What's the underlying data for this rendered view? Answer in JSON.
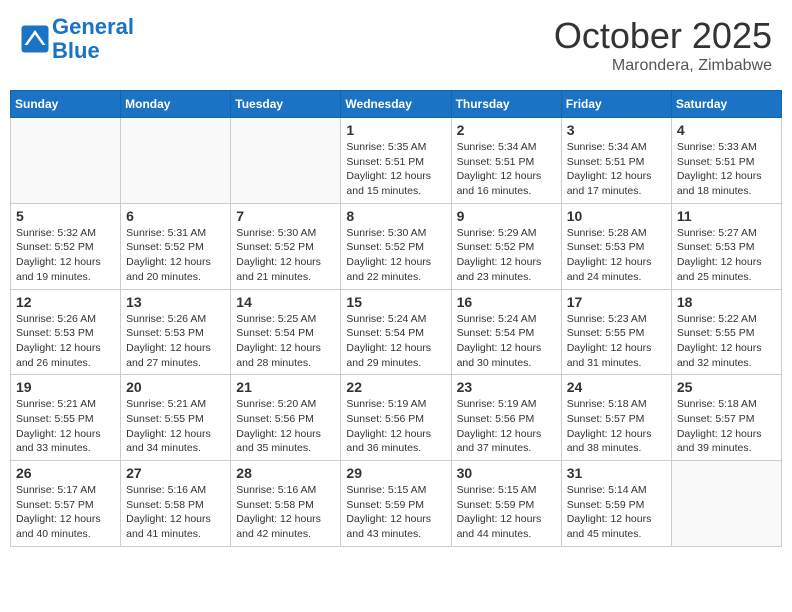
{
  "header": {
    "logo_line1": "General",
    "logo_line2": "Blue",
    "month": "October 2025",
    "location": "Marondera, Zimbabwe"
  },
  "weekdays": [
    "Sunday",
    "Monday",
    "Tuesday",
    "Wednesday",
    "Thursday",
    "Friday",
    "Saturday"
  ],
  "weeks": [
    [
      {
        "day": "",
        "info": ""
      },
      {
        "day": "",
        "info": ""
      },
      {
        "day": "",
        "info": ""
      },
      {
        "day": "1",
        "info": "Sunrise: 5:35 AM\nSunset: 5:51 PM\nDaylight: 12 hours\nand 15 minutes."
      },
      {
        "day": "2",
        "info": "Sunrise: 5:34 AM\nSunset: 5:51 PM\nDaylight: 12 hours\nand 16 minutes."
      },
      {
        "day": "3",
        "info": "Sunrise: 5:34 AM\nSunset: 5:51 PM\nDaylight: 12 hours\nand 17 minutes."
      },
      {
        "day": "4",
        "info": "Sunrise: 5:33 AM\nSunset: 5:51 PM\nDaylight: 12 hours\nand 18 minutes."
      }
    ],
    [
      {
        "day": "5",
        "info": "Sunrise: 5:32 AM\nSunset: 5:52 PM\nDaylight: 12 hours\nand 19 minutes."
      },
      {
        "day": "6",
        "info": "Sunrise: 5:31 AM\nSunset: 5:52 PM\nDaylight: 12 hours\nand 20 minutes."
      },
      {
        "day": "7",
        "info": "Sunrise: 5:30 AM\nSunset: 5:52 PM\nDaylight: 12 hours\nand 21 minutes."
      },
      {
        "day": "8",
        "info": "Sunrise: 5:30 AM\nSunset: 5:52 PM\nDaylight: 12 hours\nand 22 minutes."
      },
      {
        "day": "9",
        "info": "Sunrise: 5:29 AM\nSunset: 5:52 PM\nDaylight: 12 hours\nand 23 minutes."
      },
      {
        "day": "10",
        "info": "Sunrise: 5:28 AM\nSunset: 5:53 PM\nDaylight: 12 hours\nand 24 minutes."
      },
      {
        "day": "11",
        "info": "Sunrise: 5:27 AM\nSunset: 5:53 PM\nDaylight: 12 hours\nand 25 minutes."
      }
    ],
    [
      {
        "day": "12",
        "info": "Sunrise: 5:26 AM\nSunset: 5:53 PM\nDaylight: 12 hours\nand 26 minutes."
      },
      {
        "day": "13",
        "info": "Sunrise: 5:26 AM\nSunset: 5:53 PM\nDaylight: 12 hours\nand 27 minutes."
      },
      {
        "day": "14",
        "info": "Sunrise: 5:25 AM\nSunset: 5:54 PM\nDaylight: 12 hours\nand 28 minutes."
      },
      {
        "day": "15",
        "info": "Sunrise: 5:24 AM\nSunset: 5:54 PM\nDaylight: 12 hours\nand 29 minutes."
      },
      {
        "day": "16",
        "info": "Sunrise: 5:24 AM\nSunset: 5:54 PM\nDaylight: 12 hours\nand 30 minutes."
      },
      {
        "day": "17",
        "info": "Sunrise: 5:23 AM\nSunset: 5:55 PM\nDaylight: 12 hours\nand 31 minutes."
      },
      {
        "day": "18",
        "info": "Sunrise: 5:22 AM\nSunset: 5:55 PM\nDaylight: 12 hours\nand 32 minutes."
      }
    ],
    [
      {
        "day": "19",
        "info": "Sunrise: 5:21 AM\nSunset: 5:55 PM\nDaylight: 12 hours\nand 33 minutes."
      },
      {
        "day": "20",
        "info": "Sunrise: 5:21 AM\nSunset: 5:55 PM\nDaylight: 12 hours\nand 34 minutes."
      },
      {
        "day": "21",
        "info": "Sunrise: 5:20 AM\nSunset: 5:56 PM\nDaylight: 12 hours\nand 35 minutes."
      },
      {
        "day": "22",
        "info": "Sunrise: 5:19 AM\nSunset: 5:56 PM\nDaylight: 12 hours\nand 36 minutes."
      },
      {
        "day": "23",
        "info": "Sunrise: 5:19 AM\nSunset: 5:56 PM\nDaylight: 12 hours\nand 37 minutes."
      },
      {
        "day": "24",
        "info": "Sunrise: 5:18 AM\nSunset: 5:57 PM\nDaylight: 12 hours\nand 38 minutes."
      },
      {
        "day": "25",
        "info": "Sunrise: 5:18 AM\nSunset: 5:57 PM\nDaylight: 12 hours\nand 39 minutes."
      }
    ],
    [
      {
        "day": "26",
        "info": "Sunrise: 5:17 AM\nSunset: 5:57 PM\nDaylight: 12 hours\nand 40 minutes."
      },
      {
        "day": "27",
        "info": "Sunrise: 5:16 AM\nSunset: 5:58 PM\nDaylight: 12 hours\nand 41 minutes."
      },
      {
        "day": "28",
        "info": "Sunrise: 5:16 AM\nSunset: 5:58 PM\nDaylight: 12 hours\nand 42 minutes."
      },
      {
        "day": "29",
        "info": "Sunrise: 5:15 AM\nSunset: 5:59 PM\nDaylight: 12 hours\nand 43 minutes."
      },
      {
        "day": "30",
        "info": "Sunrise: 5:15 AM\nSunset: 5:59 PM\nDaylight: 12 hours\nand 44 minutes."
      },
      {
        "day": "31",
        "info": "Sunrise: 5:14 AM\nSunset: 5:59 PM\nDaylight: 12 hours\nand 45 minutes."
      },
      {
        "day": "",
        "info": ""
      }
    ]
  ]
}
